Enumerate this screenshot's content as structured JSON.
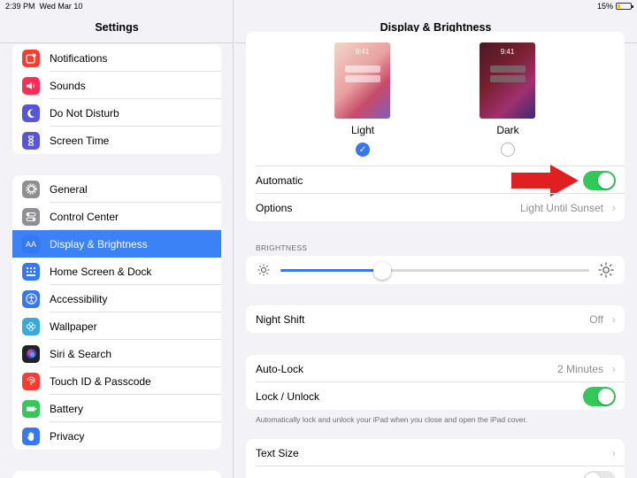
{
  "status_bar": {
    "time": "2:39 PM",
    "date": "Wed Mar 10",
    "battery": "15%"
  },
  "sidebar": {
    "title": "Settings",
    "groups": [
      [
        {
          "label": "Notifications",
          "icon": "notifications-icon",
          "color": "#ff3b30"
        },
        {
          "label": "Sounds",
          "icon": "sounds-icon",
          "color": "#ff2d55"
        },
        {
          "label": "Do Not Disturb",
          "icon": "moon-icon",
          "color": "#5856d6"
        },
        {
          "label": "Screen Time",
          "icon": "hourglass-icon",
          "color": "#5856d6"
        }
      ],
      [
        {
          "label": "General",
          "icon": "gear-icon",
          "color": "#8e8e93"
        },
        {
          "label": "Control Center",
          "icon": "toggles-icon",
          "color": "#8e8e93"
        },
        {
          "label": "Display & Brightness",
          "icon": "text-size-icon",
          "color": "#3478f6",
          "selected": true
        },
        {
          "label": "Home Screen & Dock",
          "icon": "grid-icon",
          "color": "#3478f6"
        },
        {
          "label": "Accessibility",
          "icon": "accessibility-icon",
          "color": "#3478f6"
        },
        {
          "label": "Wallpaper",
          "icon": "flower-icon",
          "color": "#35aadc"
        },
        {
          "label": "Siri & Search",
          "icon": "siri-icon",
          "color": "#222222"
        },
        {
          "label": "Touch ID & Passcode",
          "icon": "fingerprint-icon",
          "color": "#ff3b30"
        },
        {
          "label": "Battery",
          "icon": "battery-icon",
          "color": "#34c759"
        },
        {
          "label": "Privacy",
          "icon": "hand-icon",
          "color": "#3478f6"
        }
      ]
    ]
  },
  "main": {
    "title": "Display & Brightness",
    "appearance": {
      "preview_time": "9:41",
      "light_label": "Light",
      "dark_label": "Dark",
      "selected": "Light"
    },
    "automatic": {
      "label": "Automatic",
      "on": true
    },
    "options": {
      "label": "Options",
      "value": "Light Until Sunset"
    },
    "brightness": {
      "header": "BRIGHTNESS",
      "level": 0.33
    },
    "night_shift": {
      "label": "Night Shift",
      "value": "Off"
    },
    "auto_lock": {
      "label": "Auto-Lock",
      "value": "2 Minutes"
    },
    "lock_unlock": {
      "label": "Lock / Unlock",
      "on": true,
      "note": "Automatically lock and unlock your iPad when you close and open the iPad cover."
    },
    "text_size": {
      "label": "Text Size"
    },
    "accent_color": "#34c759",
    "arrow_color": "#e02020"
  }
}
